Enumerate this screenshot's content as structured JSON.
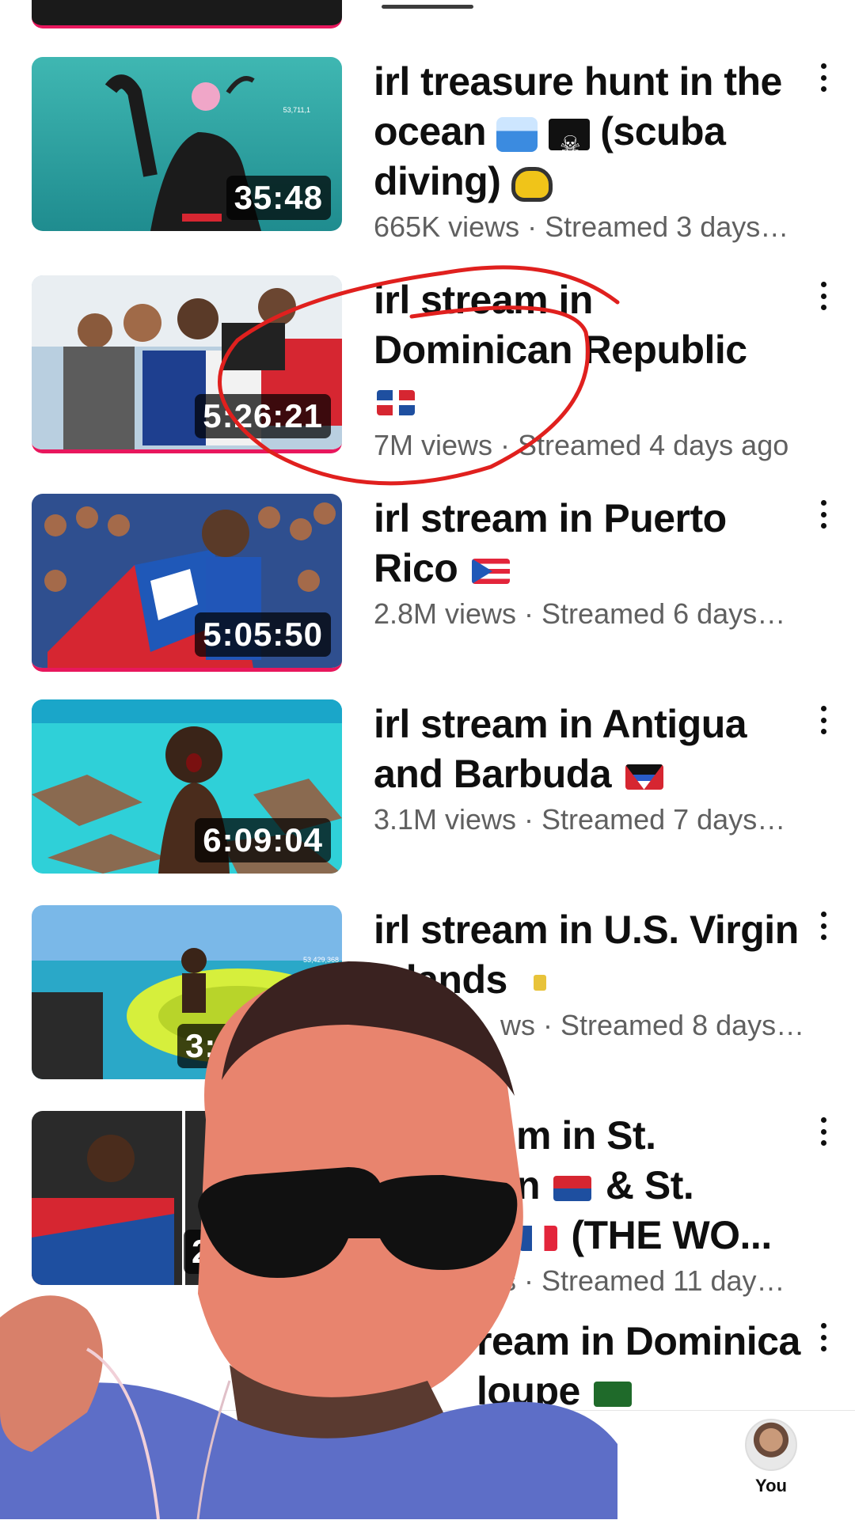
{
  "videos": [
    {
      "title": "irl treasure hunt in the ocean",
      "title_suffix": "(scuba diving)",
      "meta": "665K views · Streamed 3 days…",
      "duration": "35:48"
    },
    {
      "title": "irl stream in Dominican Republic",
      "meta": "7M views · Streamed 4 days ago",
      "duration": "5:26:21"
    },
    {
      "title": "irl stream in Puerto Rico",
      "meta": "2.8M views · Streamed 6 days…",
      "duration": "5:05:50"
    },
    {
      "title": "irl stream in Antigua and Barbuda",
      "meta": "3.1M views · Streamed 7 days…",
      "duration": "6:09:04"
    },
    {
      "title": "irl stream in U.S. Virgin Islands",
      "meta": "ws · Streamed 8 days…",
      "duration": "3:30"
    },
    {
      "title_a": "m in St.",
      "title_b": "n",
      "title_c": "& St.",
      "title_d": "(THE WO...",
      "meta": "ews · Streamed 11 day…",
      "duration": "2"
    },
    {
      "title_a": "ream in Dominica",
      "title_b": "loupe"
    }
  ],
  "thumb_counters": {
    "t1": "53,711,1",
    "t5": "53,429,368"
  },
  "nav": {
    "you_label": "You"
  },
  "colors": {
    "live_bar": "#e8175d",
    "meta_text": "#606060",
    "annotation": "#e0201e"
  },
  "icons": [
    "more-vert-icon",
    "flag-dominican-republic-icon",
    "flag-puerto-rico-icon",
    "flag-antigua-icon",
    "flag-us-virgin-islands-icon",
    "flag-sint-maarten-icon",
    "flag-france-icon",
    "flag-guadeloupe-icon"
  ]
}
